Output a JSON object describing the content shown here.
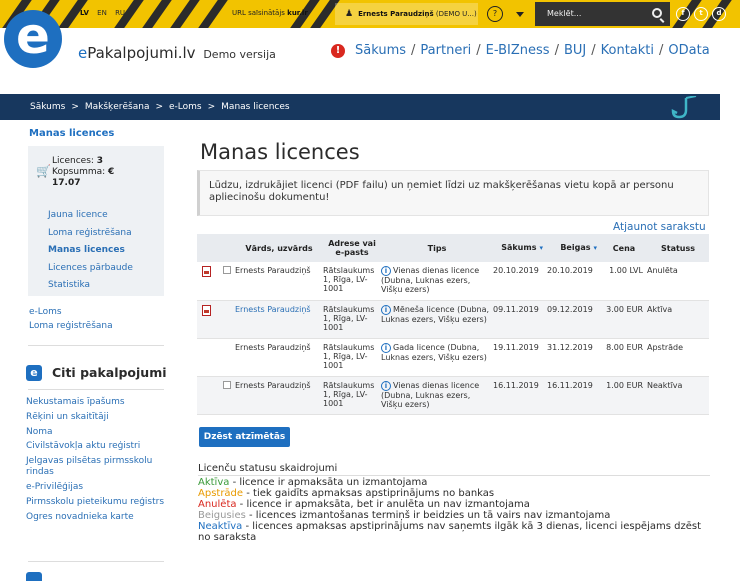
{
  "topbar": {
    "languages": [
      "LV",
      "EN",
      "RU"
    ],
    "current_language": "LV",
    "url_label": "URL saīsinātājs",
    "url_link": "kur.lr",
    "user": "Ernests Paraudziņš",
    "user_suffix": "(DEMO U...)",
    "help_icon": "?",
    "search_placeholder": "Meklēt...",
    "social": [
      "f",
      "t",
      "d"
    ]
  },
  "header": {
    "logo_letter": "e",
    "brand_prefix": "e",
    "brand_main": "Pakalpojumi.lv",
    "brand_demo": "Demo versija",
    "alert_icon": "!",
    "nav": [
      "Sākums",
      "Partneri",
      "E-BIZness",
      "BUJ",
      "Kontakti",
      "OData"
    ]
  },
  "breadcrumb": [
    "Sākums",
    "Makšķerēšana",
    "e-Loms",
    "Manas licences"
  ],
  "sidebar": {
    "title": "Manas licences",
    "cart": {
      "licences_label": "Licences:",
      "licences_count": "3",
      "total_label": "Kopsumma:",
      "total_currency": "€",
      "total_value": "17.07"
    },
    "links": [
      "Jauna licence",
      "Loma reģistrēšana",
      "Manas licences",
      "Licences pārbaude",
      "Statistika"
    ],
    "active_link": "Manas licences",
    "more": [
      "e-Loms",
      "Loma reģistrēšana"
    ],
    "other_title": "Citi pakalpojumi",
    "other_links": [
      "Nekustamais īpašums",
      "Rēķini un skaitītāji",
      "Noma",
      "Civilstāvokļa aktu reģistri",
      "Jelgavas pilsētas pirmsskolu rindas",
      "e-Privilēģijas",
      "Pirmsskolu pieteikumu reģistrs",
      "Ogres novadnieka karte"
    ]
  },
  "main": {
    "title": "Manas licences",
    "info": "Lūdzu, izdrukājiet licenci (PDF failu) un ņemiet līdzi uz makšķerēšanas vietu kopā ar personu apliecinošu dokumentu!",
    "refresh": "Atjaunot sarakstu",
    "table": {
      "headers": [
        "Vārds, uzvārds",
        "Adrese vai e-pasts",
        "Tips",
        "Sākums",
        "Beigas",
        "Cena",
        "Statuss"
      ],
      "rows": [
        {
          "name": "Ernests Paraudziņš",
          "address": "Rātslaukums 1, Rīga, LV-1001",
          "type": "Vienas dienas licence (Dubna, Luknas ezers, Višķu ezers)",
          "start": "20.10.2019",
          "end": "20.10.2019",
          "price": "1.00 LVL",
          "status": "Anulēta"
        },
        {
          "name": "Ernests Paraudziņš",
          "address": "Rātslaukums 1, Rīga, LV-1001",
          "type": "Mēneša licence (Dubna, Luknas ezers, Višķu ezers)",
          "start": "09.11.2019",
          "end": "09.12.2019",
          "price": "3.00 EUR",
          "status": "Aktīva"
        },
        {
          "name": "Ernests Paraudziņš",
          "address": "Rātslaukums 1, Rīga, LV-1001",
          "type": "Gada licence (Dubna, Luknas ezers, Višķu ezers)",
          "start": "19.11.2019",
          "end": "31.12.2019",
          "price": "8.00 EUR",
          "status": "Apstrāde"
        },
        {
          "name": "Ernests Paraudziņš",
          "address": "Rātslaukums 1, Rīga, LV-1001",
          "type": "Vienas dienas licence (Dubna, Luknas ezers, Višķu ezers)",
          "start": "16.11.2019",
          "end": "16.11.2019",
          "price": "1.00 EUR",
          "status": "Neaktīva"
        }
      ]
    },
    "delete_button": "Dzēst atzīmētās",
    "legend": {
      "title": "Licenču statusu skaidrojumi",
      "items": [
        {
          "status": "Aktīva",
          "text": " - licence ir apmaksāta un izmantojama"
        },
        {
          "status": "Apstrāde",
          "text": " - tiek gaidīts apmaksas apstiprinājums no bankas"
        },
        {
          "status": "Anulēta",
          "text": " - licence ir apmaksāta, bet ir anulēta un nav izmantojama"
        },
        {
          "status": "Beigusies",
          "text": " - licences izmantošanas termiņš ir beidzies un tā vairs nav izmantojama"
        },
        {
          "status": "Neaktīva",
          "text": " - licences apmaksas apstiprinājums nav saņemts ilgāk kā 3 dienas, licenci iespējams dzēst no saraksta"
        }
      ]
    }
  },
  "colors": {
    "brand_blue": "#1e6fc0",
    "hazard_yellow": "#f2c300",
    "navy_bar": "#17375e",
    "status_active": "#3a9a3a",
    "status_processing": "#e89a00",
    "status_cancelled": "#d9281f",
    "status_inactive": "#1e6fc0",
    "status_expired": "#999999"
  }
}
